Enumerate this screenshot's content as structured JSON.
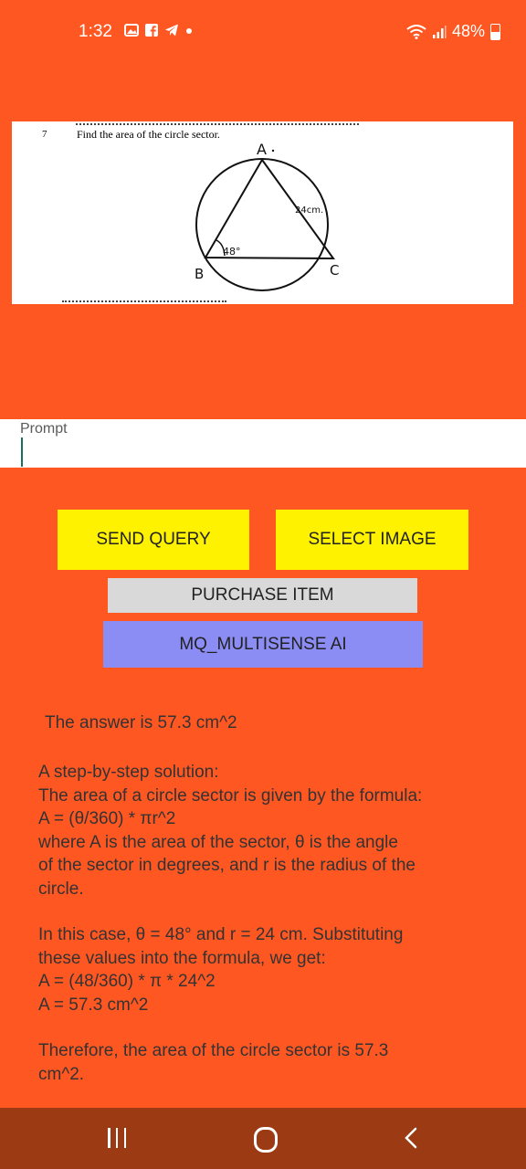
{
  "status_bar": {
    "time": "1:32",
    "battery": "48%"
  },
  "question_image": {
    "number": "7",
    "text": "Find the area of the circle sector.",
    "vertex_a": "A",
    "vertex_b": "B",
    "vertex_c": "C",
    "side_label": "24cm.",
    "angle_label": "48°"
  },
  "prompt": {
    "label": "Prompt"
  },
  "buttons": {
    "send_query": "SEND QUERY",
    "select_image": "SELECT IMAGE",
    "purchase_item": "PURCHASE ITEM",
    "mq_multisense": "MQ_MULTISENSE AI"
  },
  "response": {
    "answer": "The answer is 57.3 cm^2",
    "paragraph1": [
      "A step-by-step solution:",
      "The area of a circle sector is given by the formula:",
      "A = (θ/360) * πr^2",
      "where A is the area of the sector, θ is the angle",
      "of the sector in degrees, and r is the radius of the",
      "circle."
    ],
    "paragraph2": [
      "In this case, θ = 48° and r = 24 cm. Substituting",
      "these values into the formula, we get:",
      "A = (48/360) * π * 24^2",
      "A = 57.3 cm^2"
    ],
    "paragraph3": [
      "Therefore, the area of the circle sector is 57.3",
      "cm^2."
    ]
  },
  "colors": {
    "background": "#FF5722",
    "yellow_button": "#FFF200",
    "purchase_button": "#D9D9D9",
    "mq_button": "#8C8CF5",
    "nav_bar": "#9C3A14"
  }
}
